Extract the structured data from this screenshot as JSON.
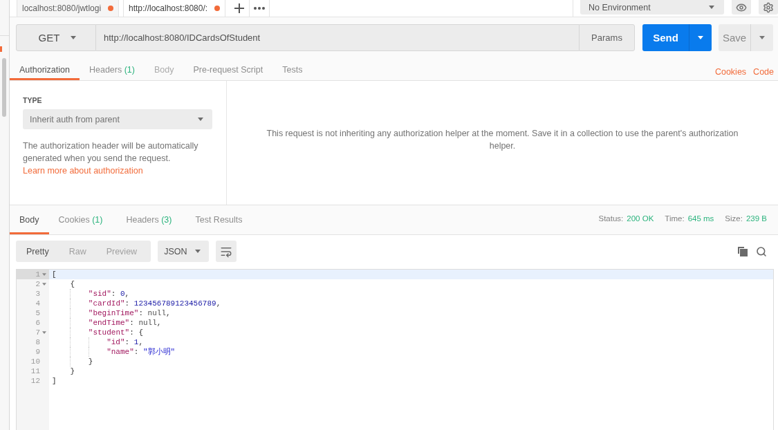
{
  "tabs": [
    {
      "label": "localhost:8080/jwtlogi",
      "selected": false,
      "unsaved": true
    },
    {
      "label": "http://localhost:8080/:",
      "selected": true,
      "unsaved": true
    }
  ],
  "environment": {
    "value": "No Environment"
  },
  "request": {
    "method": "GET",
    "url": "http://localhost:8080/IDCardsOfStudent",
    "params": "Params",
    "send": "Send",
    "save": "Save"
  },
  "request_tabs": [
    {
      "label": "Authorization",
      "selected": true,
      "disabled": false
    },
    {
      "label": "Headers",
      "count": "(1)",
      "selected": false,
      "disabled": false
    },
    {
      "label": "Body",
      "selected": false,
      "disabled": true
    },
    {
      "label": "Pre-request Script",
      "selected": false,
      "disabled": false
    },
    {
      "label": "Tests",
      "selected": false,
      "disabled": false
    }
  ],
  "request_links": [
    "Cookies",
    "Code"
  ],
  "auth": {
    "type_label": "TYPE",
    "type_value": "Inherit auth from parent",
    "description": "The authorization header will be automatically generated when you send the request.",
    "link": "Learn more about authorization",
    "message": "This request is not inheriting any authorization helper at the moment. Save it in a collection to use the parent's authorization helper."
  },
  "response_tabs": [
    {
      "label": "Body",
      "selected": true
    },
    {
      "label": "Cookies",
      "count": "(1)",
      "selected": false
    },
    {
      "label": "Headers",
      "count": "(3)",
      "selected": false
    },
    {
      "label": "Test Results",
      "selected": false
    }
  ],
  "response_meta": [
    {
      "label": "Status:",
      "value": "200 OK"
    },
    {
      "label": "Time:",
      "value": "645 ms"
    },
    {
      "label": "Size:",
      "value": "239 B"
    }
  ],
  "view_modes": [
    {
      "label": "Pretty",
      "selected": true
    },
    {
      "label": "Raw",
      "selected": false
    },
    {
      "label": "Preview",
      "selected": false
    }
  ],
  "format": "JSON",
  "code_lines": [
    {
      "number": "1",
      "foldable": true,
      "active": true,
      "tokens": [
        {
          "kind": "punct",
          "text": "["
        }
      ]
    },
    {
      "number": "2",
      "foldable": true,
      "active": false,
      "tokens": [
        {
          "kind": "punct",
          "text": "    {"
        }
      ]
    },
    {
      "number": "3",
      "foldable": false,
      "active": false,
      "tokens": [
        {
          "kind": "key",
          "text": "        \"sid\""
        },
        {
          "kind": "punct",
          "text": ": "
        },
        {
          "kind": "number",
          "text": "0"
        },
        {
          "kind": "punct",
          "text": ","
        }
      ]
    },
    {
      "number": "4",
      "foldable": false,
      "active": false,
      "tokens": [
        {
          "kind": "key",
          "text": "        \"cardId\""
        },
        {
          "kind": "punct",
          "text": ": "
        },
        {
          "kind": "number",
          "text": "123456789123456789"
        },
        {
          "kind": "punct",
          "text": ","
        }
      ]
    },
    {
      "number": "5",
      "foldable": false,
      "active": false,
      "tokens": [
        {
          "kind": "key",
          "text": "        \"beginTime\""
        },
        {
          "kind": "punct",
          "text": ": "
        },
        {
          "kind": "null",
          "text": "null"
        },
        {
          "kind": "punct",
          "text": ","
        }
      ]
    },
    {
      "number": "6",
      "foldable": false,
      "active": false,
      "tokens": [
        {
          "kind": "key",
          "text": "        \"endTime\""
        },
        {
          "kind": "punct",
          "text": ": "
        },
        {
          "kind": "null",
          "text": "null"
        },
        {
          "kind": "punct",
          "text": ","
        }
      ]
    },
    {
      "number": "7",
      "foldable": true,
      "active": false,
      "tokens": [
        {
          "kind": "key",
          "text": "        \"student\""
        },
        {
          "kind": "punct",
          "text": ": {"
        }
      ]
    },
    {
      "number": "8",
      "foldable": false,
      "active": false,
      "tokens": [
        {
          "kind": "key",
          "text": "            \"id\""
        },
        {
          "kind": "punct",
          "text": ": "
        },
        {
          "kind": "number",
          "text": "1"
        },
        {
          "kind": "punct",
          "text": ","
        }
      ]
    },
    {
      "number": "9",
      "foldable": false,
      "active": false,
      "tokens": [
        {
          "kind": "key",
          "text": "            \"name\""
        },
        {
          "kind": "punct",
          "text": ": "
        },
        {
          "kind": "string",
          "text": "\"郭小明\""
        }
      ]
    },
    {
      "number": "10",
      "foldable": false,
      "active": false,
      "tokens": [
        {
          "kind": "punct",
          "text": "        }"
        }
      ]
    },
    {
      "number": "11",
      "foldable": false,
      "active": false,
      "tokens": [
        {
          "kind": "punct",
          "text": "    }"
        }
      ]
    },
    {
      "number": "12",
      "foldable": false,
      "active": false,
      "tokens": [
        {
          "kind": "punct",
          "text": "]"
        }
      ]
    }
  ]
}
